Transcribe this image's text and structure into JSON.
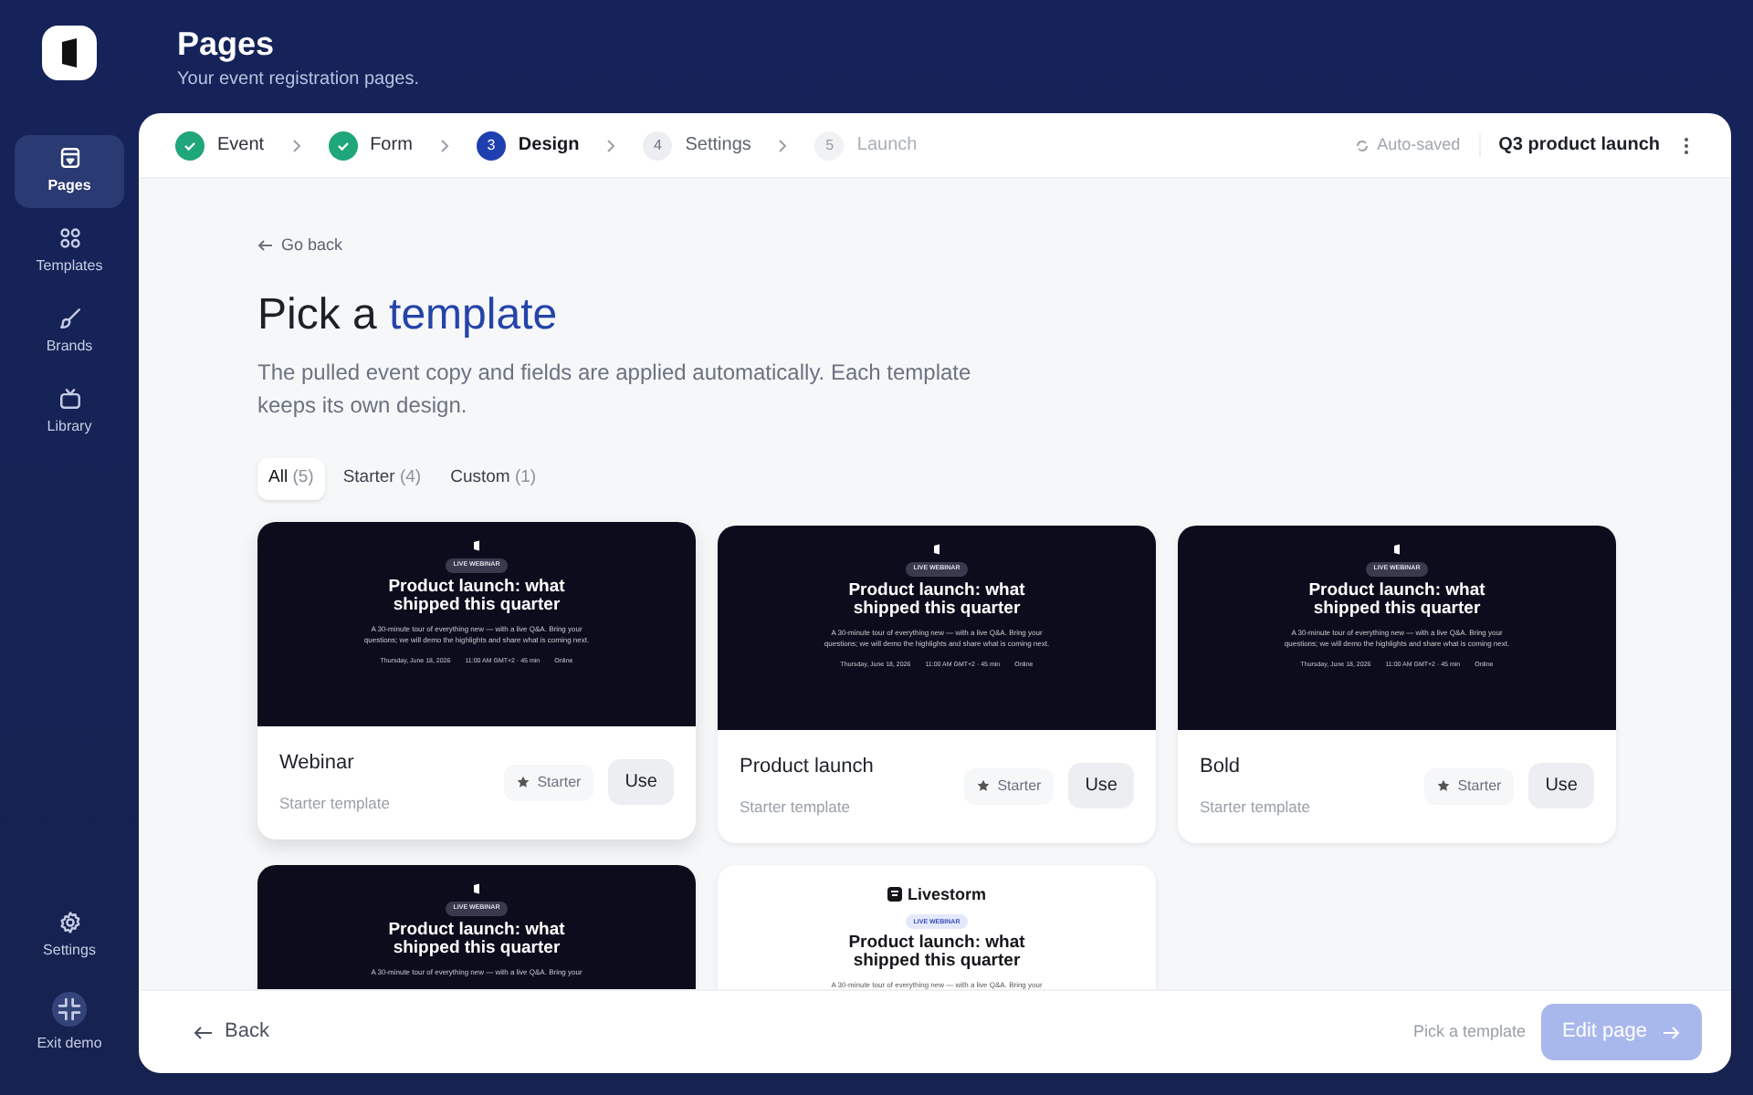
{
  "header": {
    "title": "Pages",
    "subtitle": "Your event registration pages."
  },
  "sidebar": {
    "items": [
      {
        "label": "Pages",
        "selected": true
      },
      {
        "label": "Templates",
        "selected": false
      },
      {
        "label": "Brands",
        "selected": false
      },
      {
        "label": "Library",
        "selected": false
      }
    ],
    "bottom_items": [
      {
        "label": "Settings"
      },
      {
        "label": "Exit demo"
      }
    ]
  },
  "stepper": {
    "steps": [
      {
        "label": "Event",
        "completed": true,
        "selected": false,
        "disabled": false
      },
      {
        "label": "Form",
        "completed": true,
        "selected": false,
        "disabled": false
      },
      {
        "number": "3",
        "label": "Design",
        "completed": false,
        "selected": true,
        "disabled": false
      },
      {
        "number": "4",
        "label": "Settings",
        "completed": false,
        "selected": false,
        "disabled": false
      },
      {
        "number": "5",
        "label": "Launch",
        "completed": false,
        "selected": false,
        "disabled": true
      }
    ],
    "autosave": "Auto-saved",
    "project": "Q3 product launch"
  },
  "page": {
    "back_link": "Go back",
    "heading": "Pick a",
    "heading_highlight": "template",
    "description": "The pulled event copy and fields are applied automatically. Each template keeps its own design."
  },
  "filters": [
    {
      "label": "All",
      "count": "(5)",
      "selected": true
    },
    {
      "label": "Starter",
      "count": "(4)",
      "selected": false
    },
    {
      "label": "Custom",
      "count": "(1)",
      "selected": false
    }
  ],
  "templates": [
    {
      "name": "Webinar",
      "subtitle": "Starter template",
      "badge": "Starter",
      "button": "Use",
      "dark": true,
      "preview": {
        "label": "LIVE WEBINAR",
        "title": "Product launch: what shipped this quarter",
        "description": "A 30-minute tour of everything new — with a live Q&A. Bring your questions; we will demo the highlights and share what is coming next.",
        "meta": [
          "Thursday, June 18, 2026",
          "11:00 AM GMT+2 · 45 min",
          "Online"
        ]
      }
    },
    {
      "name": "Product launch",
      "subtitle": "Starter template",
      "badge": "Starter",
      "button": "Use",
      "dark": true,
      "preview": {
        "label": "LIVE WEBINAR",
        "title": "Product launch: what shipped this quarter",
        "description": "A 30-minute tour of everything new — with a live Q&A. Bring your questions; we will demo the highlights and share what is coming next.",
        "meta": [
          "Thursday, June 18, 2026",
          "11:00 AM GMT+2 · 45 min",
          "Online"
        ]
      }
    },
    {
      "name": "Bold",
      "subtitle": "Starter template",
      "badge": "Starter",
      "button": "Use",
      "dark": true,
      "preview": {
        "label": "LIVE WEBINAR",
        "title": "Product launch: what shipped this quarter",
        "description": "A 30-minute tour of everything new — with a live Q&A. Bring your questions; we will demo the highlights and share what is coming next.",
        "meta": [
          "Thursday, June 18, 2026",
          "11:00 AM GMT+2 · 45 min",
          "Online"
        ]
      }
    },
    {
      "dark": true,
      "preview": {
        "label": "LIVE WEBINAR",
        "title": "Product launch: what shipped this quarter",
        "description": "A 30-minute tour of everything new — with a live Q&A. Bring your"
      }
    },
    {
      "dark": false,
      "preview": {
        "brand": "Livestorm",
        "label": "LIVE WEBINAR",
        "title": "Product launch: what shipped this quarter",
        "description": "A 30-minute tour of everything new — with a live Q&A. Bring your"
      }
    }
  ],
  "footer": {
    "back_button": "Back",
    "hint": "Pick a template",
    "primary_button": "Edit page",
    "primary_disabled": true
  }
}
